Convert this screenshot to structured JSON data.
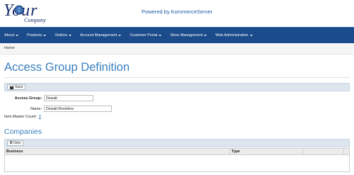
{
  "brand": {
    "logo_text": "Your",
    "logo_sub": "Company",
    "powered_by": "Powered by KommerceServer"
  },
  "nav": {
    "items": [
      {
        "label": "About",
        "dropdown": true
      },
      {
        "label": "Products",
        "dropdown": true
      },
      {
        "label": "Visitors",
        "dropdown": true
      },
      {
        "label": "Account Management",
        "dropdown": true
      },
      {
        "label": "Customer Portal",
        "dropdown": true
      },
      {
        "label": "Store Management",
        "dropdown": true
      },
      {
        "label": "Web Administration",
        "dropdown": true
      }
    ]
  },
  "breadcrumb": {
    "home": "Home"
  },
  "page": {
    "title": "Access Group Definition"
  },
  "toolbar": {
    "save_label": "Save"
  },
  "form": {
    "access_group_label": "Access Group:",
    "access_group_value": "Dewalt",
    "name_label": "Name:",
    "name_value": "Dewalt Resellers",
    "item_master_count_label": "Item Master Count:",
    "item_master_count_value": "0"
  },
  "companies": {
    "title": "Companies",
    "new_label": "New",
    "columns": [
      "Business",
      "Type",
      "",
      ""
    ]
  },
  "colors": {
    "accent": "#3a7fbf",
    "navbar": "#1b4b8a",
    "link": "#1b5ea6"
  }
}
